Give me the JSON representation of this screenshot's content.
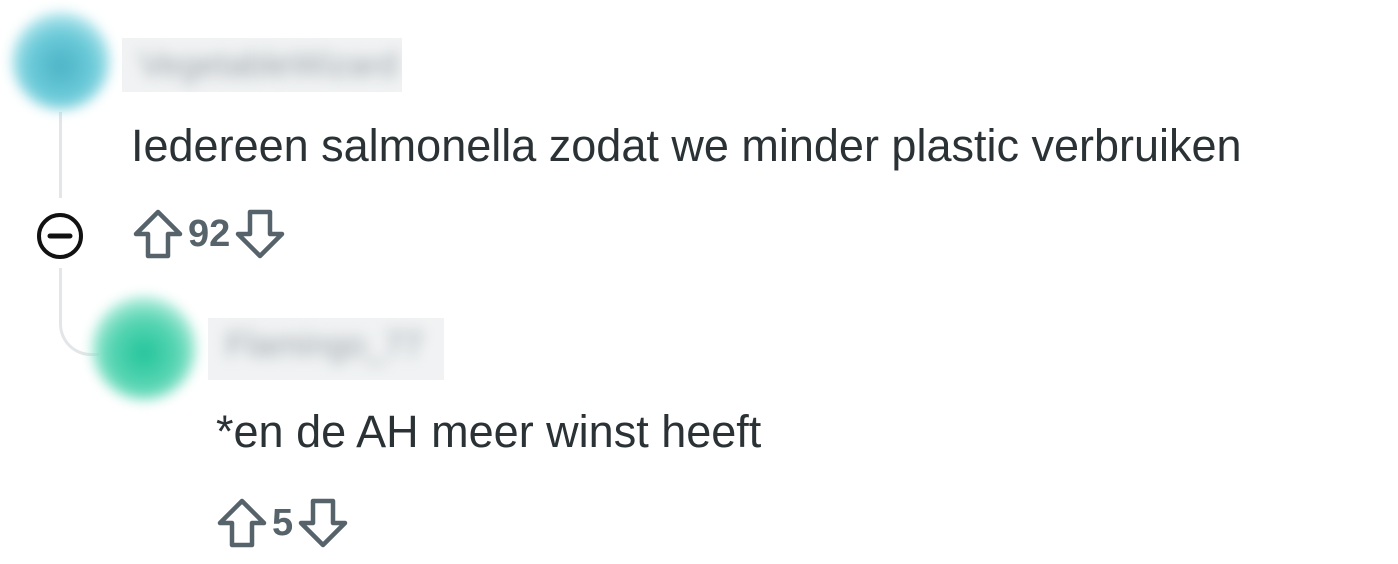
{
  "comments": [
    {
      "author": "VegetableWizard",
      "body": "Iedereen salmonella zodat we minder plastic verbruiken",
      "score": "92"
    },
    {
      "author": "Flamingo_77",
      "body": "*en de AH meer winst heeft",
      "score": "5"
    }
  ],
  "icons": {
    "upvote": "arrow-up-outline",
    "downvote": "arrow-down-outline",
    "collapse": "circle-minus"
  },
  "colors": {
    "text": "#2a3236",
    "score": "#56636b",
    "icon": "#56636b",
    "thread_line": "#e3e6e8",
    "avatar_1": "#4bb3c6",
    "avatar_2": "#22c49a"
  }
}
